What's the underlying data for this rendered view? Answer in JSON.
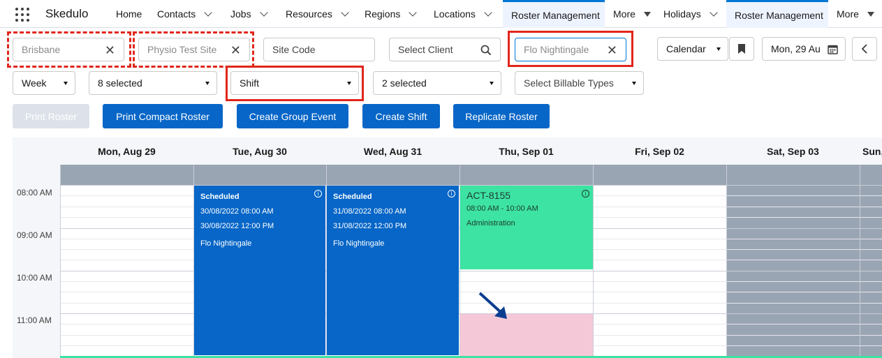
{
  "app": {
    "brand": "Skedulo"
  },
  "nav": [
    {
      "label": "Home"
    },
    {
      "label": "Contacts"
    },
    {
      "label": "Jobs"
    },
    {
      "label": "Resources"
    },
    {
      "label": "Regions"
    },
    {
      "label": "Locations"
    },
    {
      "label": "Roster Management",
      "active": true
    },
    {
      "label": "More"
    },
    {
      "label": "Holidays"
    },
    {
      "label": "Roster Management",
      "active": true
    },
    {
      "label": "More"
    }
  ],
  "filters": {
    "region": {
      "placeholder": "Brisbane"
    },
    "site": {
      "placeholder": "Physio Test Site"
    },
    "site_code": {
      "placeholder": "Site Code"
    },
    "client": {
      "placeholder": "Select Client"
    },
    "resource": {
      "placeholder": "Flo Nightingale"
    },
    "view": {
      "value": "Calendar"
    },
    "date": {
      "value": "Mon, 29 Au"
    },
    "period": {
      "value": "Week"
    },
    "statuses": {
      "value": "8 selected"
    },
    "type": {
      "value": "Shift"
    },
    "categories": {
      "value": "2 selected"
    },
    "billable": {
      "placeholder": "Select Billable Types"
    }
  },
  "actions": {
    "print_roster": "Print Roster",
    "print_compact": "Print Compact Roster",
    "create_group_event": "Create Group Event",
    "create_shift": "Create Shift",
    "replicate_roster": "Replicate Roster"
  },
  "calendar": {
    "days": [
      "Mon, Aug 29",
      "Tue, Aug 30",
      "Wed, Aug 31",
      "Thu, Sep 01",
      "Fri, Sep 02",
      "Sat, Sep 03",
      "Sun,"
    ],
    "times": [
      "08:00 AM",
      "09:00 AM",
      "10:00 AM",
      "11:00 AM"
    ],
    "events": [
      {
        "status": "Scheduled",
        "start": "30/08/2022 08:00 AM",
        "end": "30/08/2022 12:00 PM",
        "resource": "Flo Nightingale"
      },
      {
        "status": "Scheduled",
        "start": "31/08/2022 08:00 AM",
        "end": "31/08/2022 12:00 PM",
        "resource": "Flo Nightingale"
      },
      {
        "title": "ACT-8155",
        "time": "08:00 AM - 10:00 AM",
        "category": "Administration"
      }
    ]
  },
  "colors": {
    "primary": "#0766c7",
    "activity": "#3de3a3",
    "selection": "#f5c8d8",
    "highlight": "#e1261c",
    "weekend": "#9aa5b4"
  }
}
